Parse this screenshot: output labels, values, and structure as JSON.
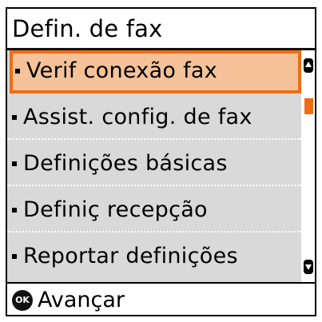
{
  "header": {
    "title": "Defin. de fax"
  },
  "menu": {
    "items": [
      {
        "label": "Verif conexão fax",
        "selected": true
      },
      {
        "label": "Assist. config. de fax",
        "selected": false
      },
      {
        "label": "Definições básicas",
        "selected": false
      },
      {
        "label": "Definiç recepção",
        "selected": false
      },
      {
        "label": "Reportar definições",
        "selected": false
      }
    ]
  },
  "scrollbar": {
    "up_icon": "scroll-up-arrow-icon",
    "down_icon": "scroll-down-arrow-icon"
  },
  "footer": {
    "ok_icon_text": "OK",
    "action_label": "Avançar"
  },
  "colors": {
    "accent": "#ef6c16",
    "selection_fill": "#f6c29a",
    "list_background": "#d9d9d9"
  }
}
